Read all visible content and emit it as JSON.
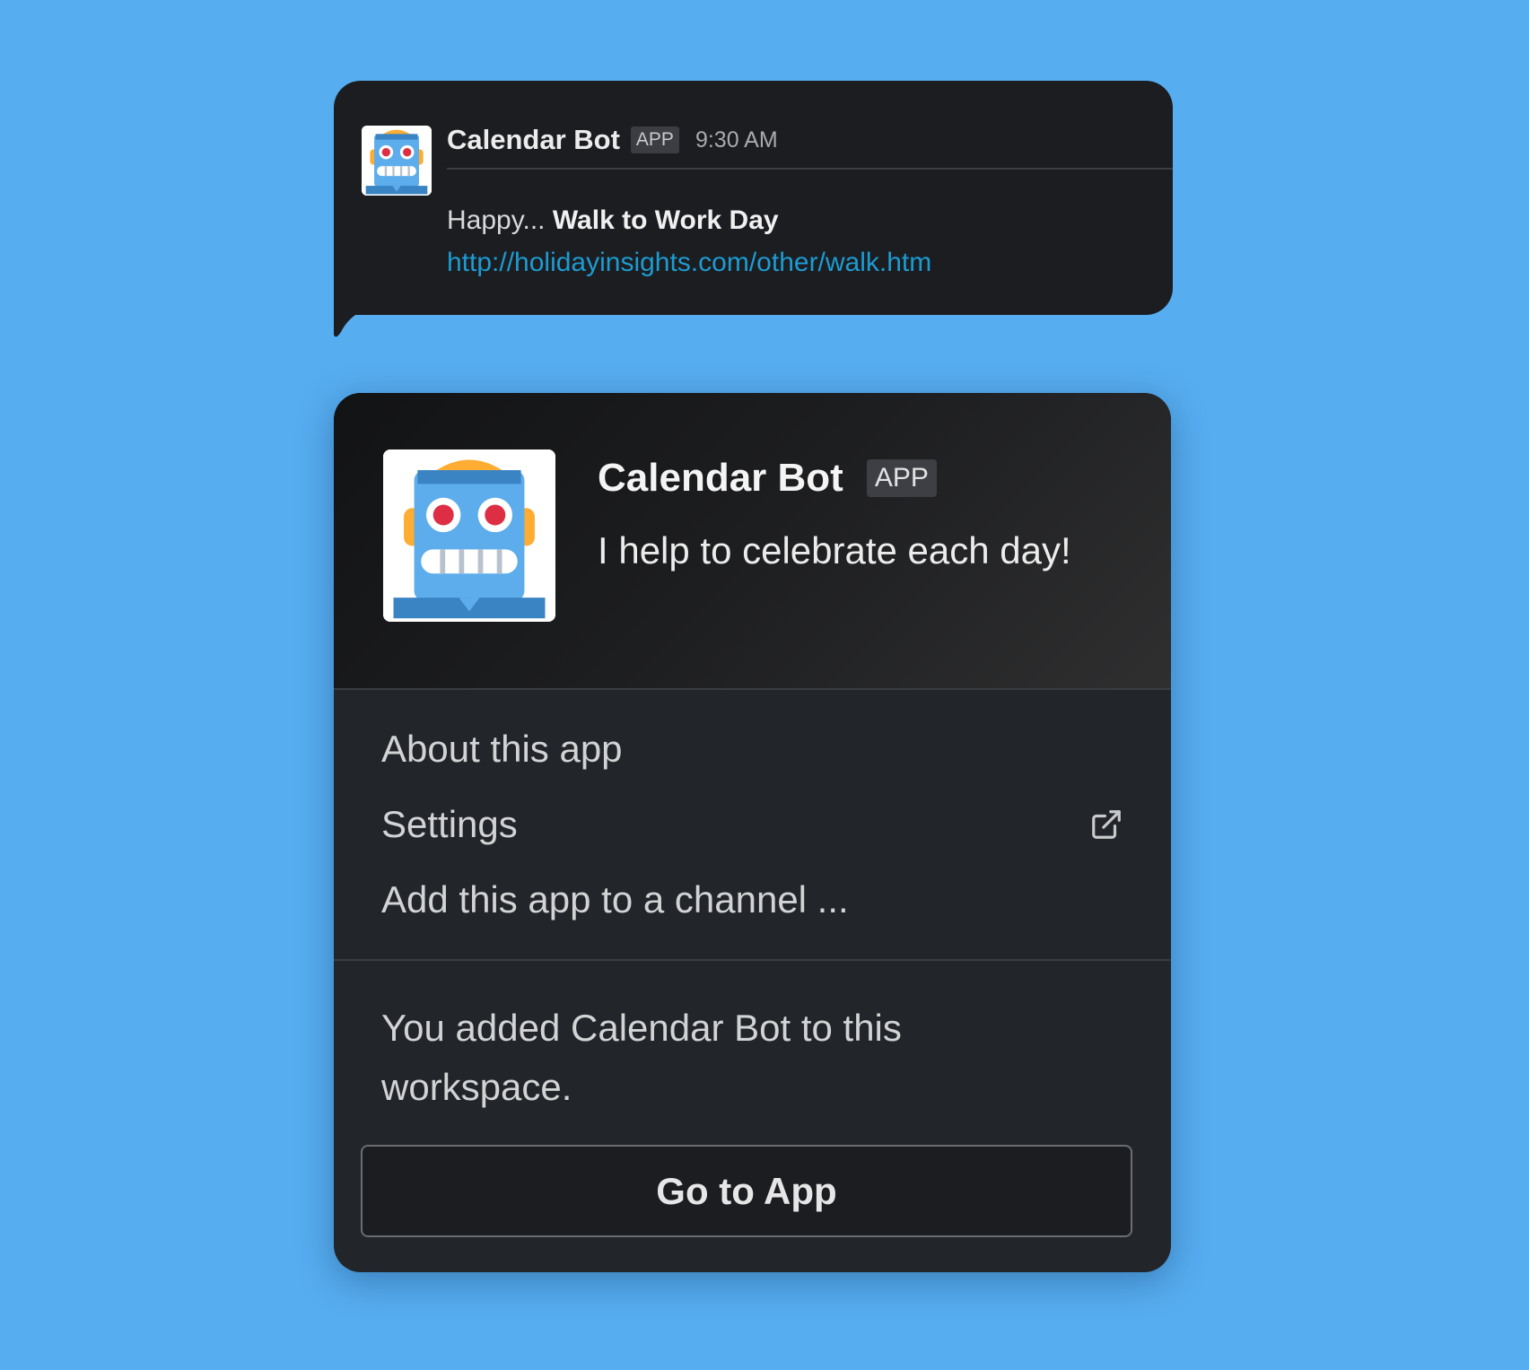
{
  "message": {
    "sender": "Calendar Bot",
    "badge": "APP",
    "time": "9:30 AM",
    "text_prefix": "Happy...",
    "text_bold": "Walk to Work Day",
    "link": "http://holidayinsights.com/other/walk.htm",
    "avatar_icon": "robot-icon"
  },
  "profile": {
    "name": "Calendar Bot",
    "badge": "APP",
    "tagline": "I help to celebrate each day!",
    "avatar_icon": "robot-icon"
  },
  "menu": {
    "items": [
      {
        "label": "About this app"
      },
      {
        "label": "Settings",
        "icon": "external-link-icon"
      },
      {
        "label": "Add this app to a channel ..."
      }
    ]
  },
  "footer": {
    "note": "You added Calendar Bot to this workspace.",
    "button_label": "Go to App"
  },
  "colors": {
    "background": "#56adf0",
    "panel": "#222529",
    "link": "#1d9bd1",
    "robot_blue": "#5dadec",
    "robot_eye": "#dd2e44",
    "robot_orange": "#ffac33"
  }
}
